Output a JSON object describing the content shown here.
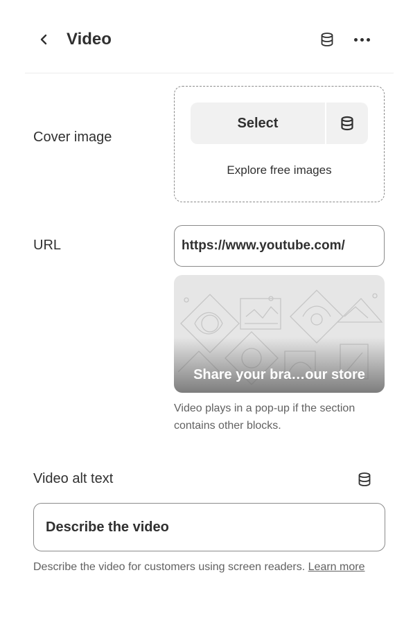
{
  "header": {
    "title": "Video",
    "back_icon": "chevron-left-icon",
    "source_icon": "database-icon",
    "more_icon": "ellipsis-icon"
  },
  "cover_image": {
    "label": "Cover image",
    "select_label": "Select",
    "explore_label": "Explore free images"
  },
  "url": {
    "label": "URL",
    "value": "https://www.youtube.com/"
  },
  "video_preview": {
    "caption": "Share your bra…our store",
    "help": "Video plays in a pop-up if the section contains other blocks."
  },
  "alt_text": {
    "label": "Video alt text",
    "placeholder": "Describe the video",
    "help": "Describe the video for customers using screen readers.",
    "learn_more": "Learn more"
  },
  "colors": {
    "text": "#303030",
    "subdued": "#616161",
    "border": "#8a8a8a",
    "surface": "#f1f1f1"
  }
}
